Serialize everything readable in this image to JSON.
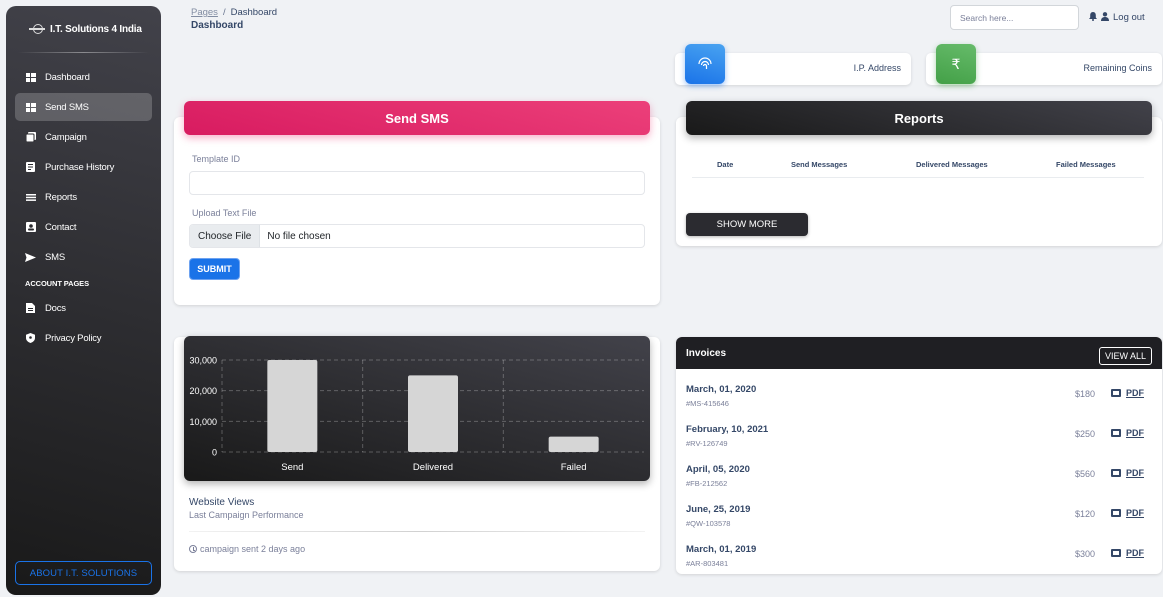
{
  "brand": {
    "name": "I.T. Solutions 4 India"
  },
  "sidebar": {
    "items": [
      {
        "label": "Dashboard",
        "icon": "dashboard-icon"
      },
      {
        "label": "Send SMS",
        "icon": "table-icon",
        "active": true
      },
      {
        "label": "Campaign",
        "icon": "receipt-icon"
      },
      {
        "label": "Purchase History",
        "icon": "history-icon"
      },
      {
        "label": "Reports",
        "icon": "reports-icon"
      },
      {
        "label": "Contact",
        "icon": "contact-icon"
      },
      {
        "label": "SMS",
        "icon": "send-icon"
      }
    ],
    "account_heading": "ACCOUNT PAGES",
    "account_items": [
      {
        "label": "Docs",
        "icon": "document-icon"
      },
      {
        "label": "Privacy Policy",
        "icon": "shield-icon"
      }
    ],
    "about_label": "ABOUT I.T. SOLUTIONS"
  },
  "header": {
    "breadcrumb_root": "Pages",
    "breadcrumb_separator": "/",
    "breadcrumb_current": "Dashboard",
    "title": "Dashboard",
    "search_placeholder": "Search here...",
    "logout_label": "Log out"
  },
  "stats": {
    "ip_label": "I.P. Address",
    "coins_label": "Remaining Coins",
    "coins_symbol": "₹"
  },
  "send_sms": {
    "title": "Send SMS",
    "template_label": "Template ID",
    "template_value": "",
    "upload_label": "Upload Text File",
    "choose_file": "Choose File",
    "no_file": "No file chosen",
    "submit": "SUBMIT"
  },
  "reports": {
    "title": "Reports",
    "columns": [
      "Date",
      "Send Messages",
      "Delivered Messages",
      "Failed Messages"
    ],
    "show_more": "SHOW MORE"
  },
  "chart_card": {
    "title": "Website Views",
    "subtitle": "Last Campaign Performance",
    "footer": "campaign sent 2 days ago"
  },
  "chart_data": {
    "type": "bar",
    "categories": [
      "Send",
      "Delivered",
      "Failed"
    ],
    "values": [
      30000,
      25000,
      5000
    ],
    "yticks": [
      0,
      10000,
      20000,
      30000
    ],
    "ytick_labels": [
      "0",
      "10,000",
      "20,000",
      "30,000"
    ],
    "ylim": [
      0,
      30000
    ],
    "bar_color": "#d6d6d6",
    "grid": true
  },
  "invoices": {
    "title": "Invoices",
    "view_all": "VIEW ALL",
    "pdf_label": "PDF",
    "rows": [
      {
        "date": "March, 01, 2020",
        "id": "#MS-415646",
        "amount": "$180"
      },
      {
        "date": "February, 10, 2021",
        "id": "#RV-126749",
        "amount": "$250"
      },
      {
        "date": "April, 05, 2020",
        "id": "#FB-212562",
        "amount": "$560"
      },
      {
        "date": "June, 25, 2019",
        "id": "#QW-103578",
        "amount": "$120"
      },
      {
        "date": "March, 01, 2019",
        "id": "#AR-803481",
        "amount": "$300"
      }
    ]
  },
  "colors": {
    "send_sms_header": "#e91e63",
    "ip_icon": "#1a73e8",
    "coins_icon": "#43a047",
    "dark": "#191919"
  }
}
